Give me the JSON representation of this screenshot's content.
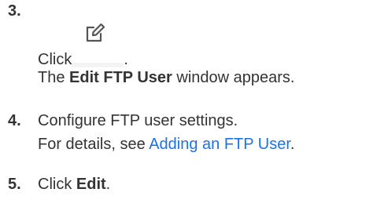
{
  "steps": [
    {
      "number": "3.",
      "lines": [
        {
          "prefix": "Click",
          "icon": "edit-icon",
          "suffix": "."
        },
        {
          "bold": "Edit FTP User",
          "rest": " window appears.",
          "lead": "The "
        }
      ]
    },
    {
      "number": "4.",
      "lines": [
        {
          "text": "Configure FTP user settings."
        },
        {
          "lead": "For details, see ",
          "link": "Adding an FTP User",
          "trail": "."
        }
      ]
    },
    {
      "number": "5.",
      "lines": [
        {
          "lead": "Click ",
          "bold": "Edit",
          "trail": "."
        }
      ]
    }
  ],
  "colors": {
    "text": "#333333",
    "link": "#1a73e8"
  }
}
